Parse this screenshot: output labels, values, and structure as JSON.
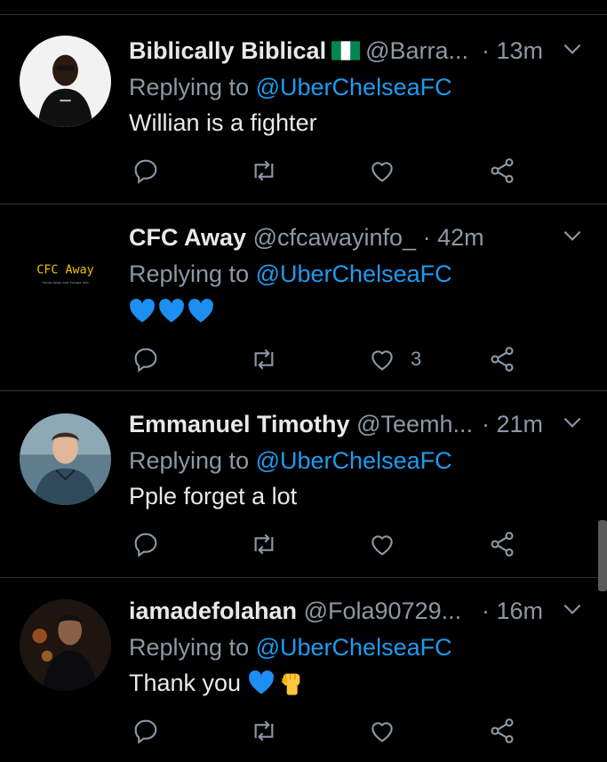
{
  "tweets": [
    {
      "name": "Biblically Biblical",
      "handle": "@Barra...",
      "time": "· 13m",
      "reply_prefix": "Replying to",
      "mention": "@UberChelseaFC",
      "text": "Willian is a fighter",
      "likes": ""
    },
    {
      "name": "CFC Away",
      "handle": "@cfcawayinfo_",
      "time": "· 42m",
      "reply_prefix": "Replying to",
      "mention": "@UberChelseaFC",
      "text": "",
      "likes": "3",
      "avatar_text": "CFC Away",
      "avatar_subtext": "Home Away and Europe Info"
    },
    {
      "name": "Emmanuel Timothy",
      "handle": "@Teemh...",
      "time": "· 21m",
      "reply_prefix": "Replying to",
      "mention": "@UberChelseaFC",
      "text": "Pple forget a lot",
      "likes": ""
    },
    {
      "name": "iamadefolahan",
      "handle": "@Fola90729...",
      "time": "· 16m",
      "reply_prefix": "Replying to",
      "mention": "@UberChelseaFC",
      "text": "Thank you",
      "likes": ""
    }
  ],
  "icons": {
    "reply": "reply-icon",
    "retweet": "retweet-icon",
    "like": "heart-icon",
    "share": "share-icon",
    "more": "chevron-down-icon"
  },
  "colors": {
    "background": "#000000",
    "text": "#e7e9ea",
    "secondary": "#8b98a5",
    "accent": "#1d9bf0",
    "divider": "#2f3336"
  }
}
